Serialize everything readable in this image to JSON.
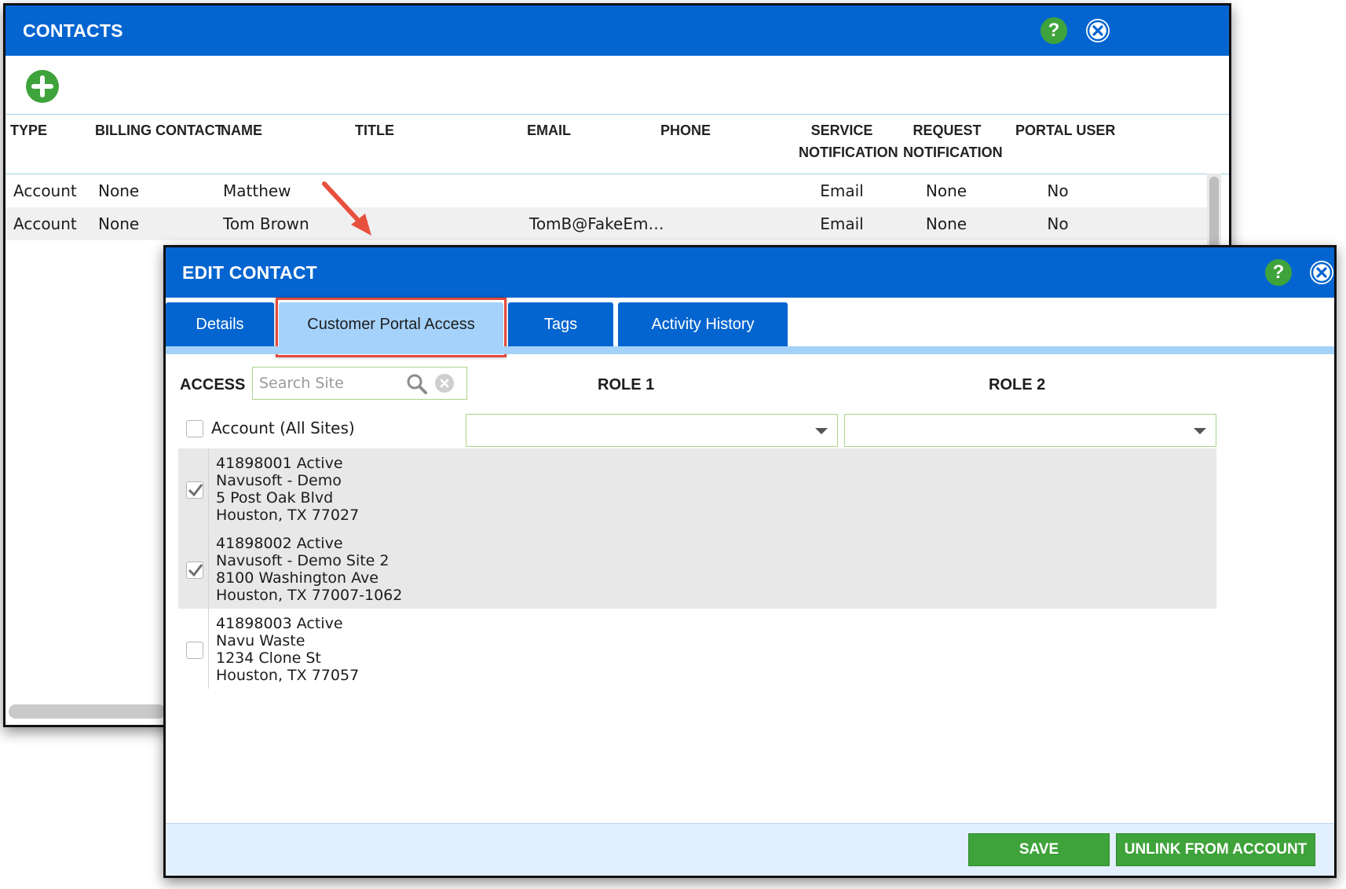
{
  "contacts": {
    "title": "CONTACTS",
    "help_label": "?",
    "columns": {
      "type": "TYPE",
      "billing": "BILLING CONTACT",
      "name": "NAME",
      "title": "TITLE",
      "email": "EMAIL",
      "phone": "PHONE",
      "service1": "SERVICE",
      "service2": "NOTIFICATION",
      "request1": "REQUEST",
      "request2": "NOTIFICATION",
      "portal": "PORTAL USER"
    },
    "rows": [
      {
        "type": "Account",
        "billing": "None",
        "name": "Matthew",
        "title": "",
        "email": "",
        "phone": "",
        "service": "Email",
        "request": "None",
        "portal": "No"
      },
      {
        "type": "Account",
        "billing": "None",
        "name": "Tom Brown",
        "title": "",
        "email": "TomB@FakeEm…",
        "phone": "",
        "service": "Email",
        "request": "None",
        "portal": "No"
      }
    ]
  },
  "edit": {
    "title": "EDIT CONTACT",
    "help_label": "?",
    "tabs": [
      {
        "label": "Details",
        "active": false
      },
      {
        "label": "Customer Portal Access",
        "active": true
      },
      {
        "label": "Tags",
        "active": false
      },
      {
        "label": "Activity History",
        "active": false
      }
    ],
    "access_label": "ACCESS",
    "search_placeholder": "Search Site",
    "role1": "ROLE 1",
    "role2": "ROLE 2",
    "account_all_label": "Account (All Sites)",
    "account_all_checked": false,
    "sites": [
      {
        "checked": true,
        "lines": [
          "41898001 Active",
          "Navusoft - Demo",
          "5 Post Oak Blvd",
          "Houston, TX 77027"
        ]
      },
      {
        "checked": true,
        "lines": [
          "41898002 Active",
          "Navusoft - Demo Site 2",
          "8100 Washington Ave",
          "Houston, TX 77007-1062"
        ]
      },
      {
        "checked": false,
        "lines": [
          "41898003 Active",
          "Navu Waste",
          "1234 Clone St",
          "Houston, TX 77057"
        ]
      }
    ],
    "buttons": {
      "save": "SAVE",
      "unlink": "UNLINK FROM ACCOUNT"
    }
  },
  "colors": {
    "titlebar": "#0565d0",
    "tab_active": "#a5d2fb",
    "button_green": "#3fa33b",
    "highlight": "#e54a3c"
  }
}
